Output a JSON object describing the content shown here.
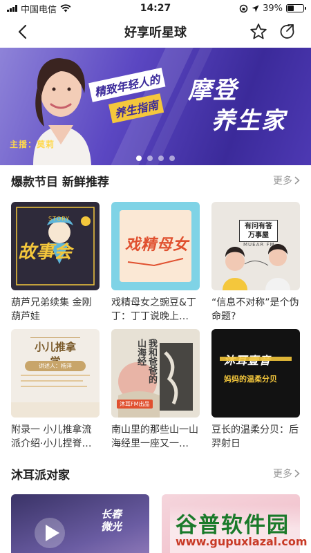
{
  "status_bar": {
    "carrier": "中国电信",
    "time": "14:27",
    "battery": "39%",
    "battery_level": 0.39
  },
  "nav": {
    "title": "好享听星球",
    "back_icon": "chevron-left-icon",
    "favorite_icon": "star-outline-icon",
    "share_icon": "share-arrow-icon"
  },
  "banner": {
    "host_label": "主播：莫莉",
    "slogan_line1": "精致年轻人的",
    "slogan_line2": "养生指南",
    "title_line1": "摩登",
    "title_line2": "养生家",
    "slide_count": 4,
    "active_slide": 1
  },
  "section1": {
    "title": "爆款节目 新鲜推荐",
    "more": "更多"
  },
  "programs": [
    {
      "title": "葫芦兄弟续集 金刚葫芦娃",
      "cover_text": "故事会",
      "cover_subtext": "STORY"
    },
    {
      "title": "戏精母女之豌豆&丁丁：丁丁说晚上…",
      "cover_text": "戏精母女",
      "cover_subtext": ""
    },
    {
      "title": "“信息不对称”是个伪命题?",
      "cover_text": "有问有答 万事屋",
      "cover_subtext": "MUEAR FM"
    },
    {
      "title": "附录一 小儿推拿流派介绍·小儿捏脊…",
      "cover_text": "小儿推拿学",
      "cover_subtext": "讲述人：杨洋"
    },
    {
      "title": "南山里的那些山一山海经里一座又一…",
      "cover_text": "我和爸爸的山海经",
      "cover_subtext": "沐耳FM出品"
    },
    {
      "title": "豆长的温柔分贝：后羿射日",
      "cover_text": "沐耳壹音",
      "cover_subtext": "妈妈的温柔分贝"
    }
  ],
  "section2": {
    "title": "沐耳派对家",
    "more": "更多"
  },
  "party": [
    {
      "cover_text": "长春微光"
    },
    {
      "cover_text": ""
    }
  ],
  "watermark": {
    "logo": "谷普软件园",
    "url": "www.gupuxlazal.com"
  }
}
